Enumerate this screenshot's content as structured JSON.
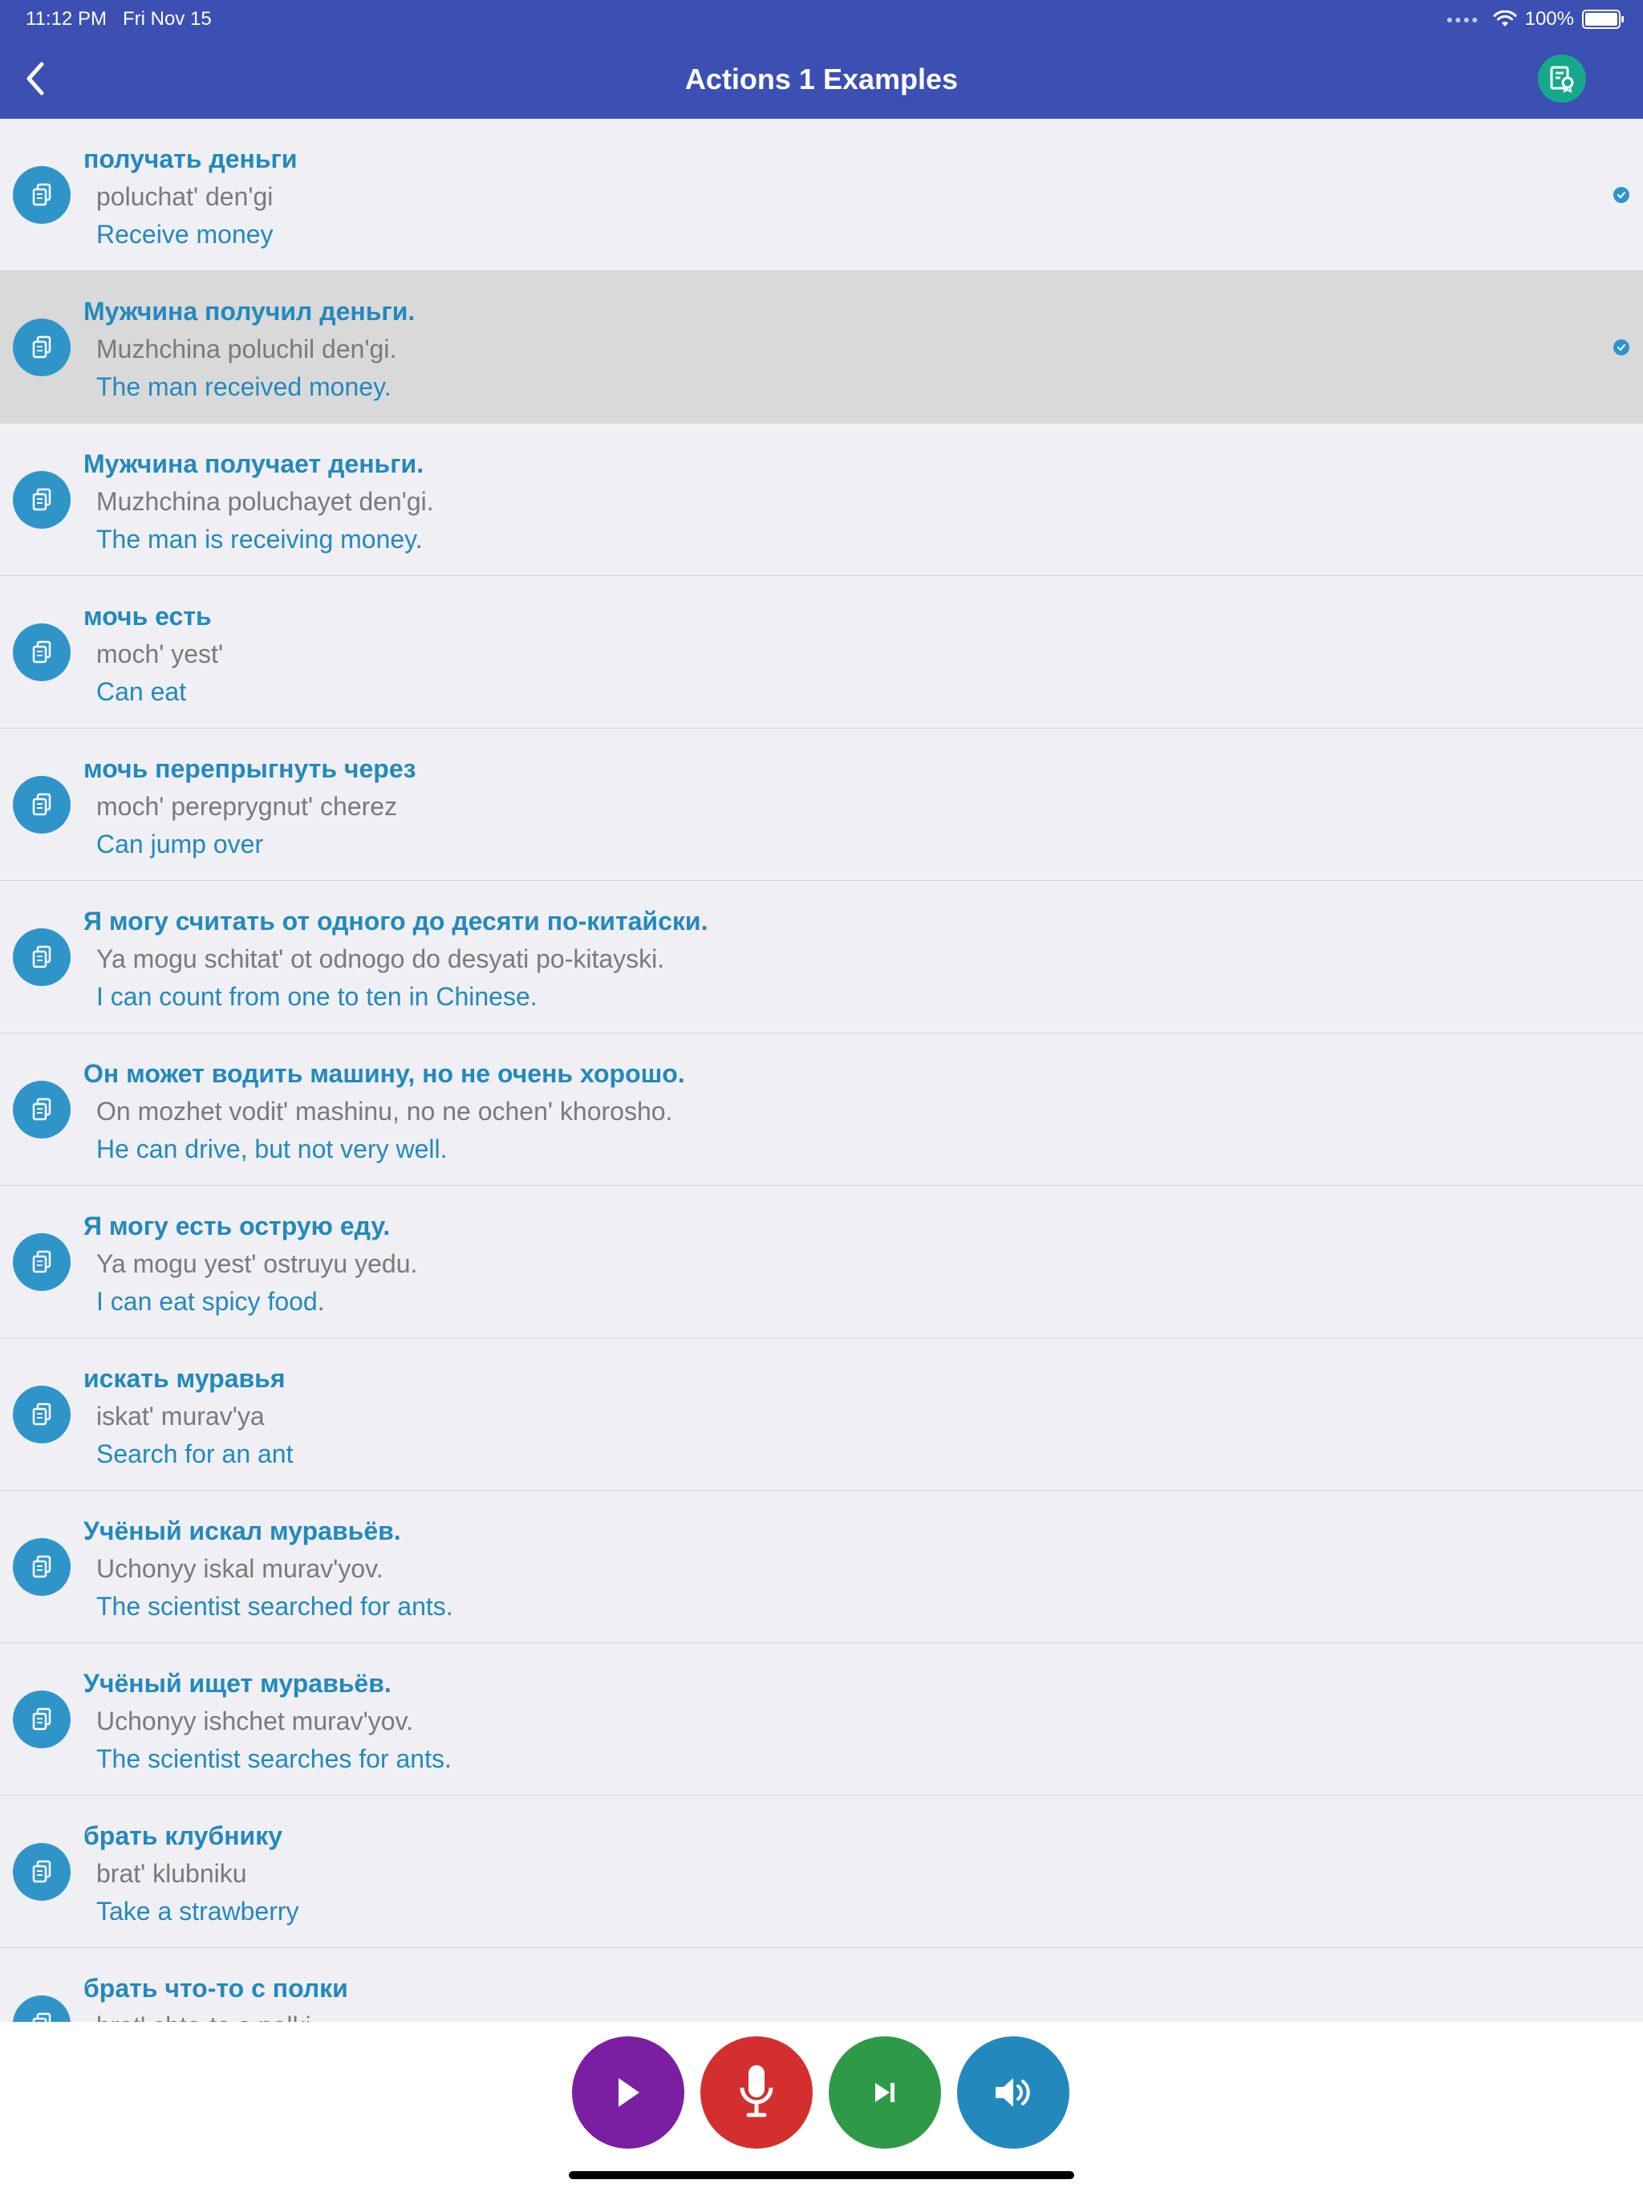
{
  "status_bar": {
    "time": "11:12 PM",
    "date": "Fri Nov 15",
    "battery": "100%"
  },
  "nav": {
    "title": "Actions 1 Examples",
    "back_icon": "chevron-left-icon",
    "action_icon": "certificate-icon"
  },
  "items": [
    {
      "ru": "получать деньги",
      "tr": "poluchat' den'gi",
      "en": "Receive money",
      "checked": true,
      "selected": false
    },
    {
      "ru": "Мужчина получил деньги.",
      "tr": "Muzhchina poluchil den'gi.",
      "en": "The man received money.",
      "checked": true,
      "selected": true
    },
    {
      "ru": "Мужчина получает деньги.",
      "tr": "Muzhchina poluchayet den'gi.",
      "en": "The man is receiving money.",
      "checked": false,
      "selected": false
    },
    {
      "ru": "мочь есть",
      "tr": "moch' yest'",
      "en": "Can eat",
      "checked": false,
      "selected": false
    },
    {
      "ru": "мочь перепрыгнуть через",
      "tr": "moch' pereprygnut' cherez",
      "en": "Can jump over",
      "checked": false,
      "selected": false
    },
    {
      "ru": "Я могу считать от одного до десяти по-китайски.",
      "tr": "Ya mogu schitat' ot odnogo do desyati po-kitayski.",
      "en": "I can count from one to ten in Chinese.",
      "checked": false,
      "selected": false
    },
    {
      "ru": "Он может водить машину, но не очень хорошо.",
      "tr": "On mozhet vodit' mashinu, no ne ochen' khorosho.",
      "en": "He can drive, but not very well.",
      "checked": false,
      "selected": false
    },
    {
      "ru": "Я могу есть острую еду.",
      "tr": "Ya mogu yest' ostruyu yedu.",
      "en": "I can eat spicy food.",
      "checked": false,
      "selected": false
    },
    {
      "ru": "искать муравья",
      "tr": "iskat' murav'ya",
      "en": "Search for an ant",
      "checked": false,
      "selected": false
    },
    {
      "ru": "Учёный искал муравьёв.",
      "tr": "Uchonyy iskal murav'yov.",
      "en": "The scientist searched for ants.",
      "checked": false,
      "selected": false
    },
    {
      "ru": "Учёный ищет муравьёв.",
      "tr": "Uchonyy ishchet murav'yov.",
      "en": "The scientist searches for ants.",
      "checked": false,
      "selected": false
    },
    {
      "ru": "брать клубнику",
      "tr": "brat' klubniku",
      "en": "Take a strawberry",
      "checked": false,
      "selected": false
    },
    {
      "ru": "брать что-то с полки",
      "tr": "brat' chto-to s polki",
      "en": "",
      "checked": false,
      "selected": false
    }
  ],
  "controls": {
    "play_icon": "play-icon",
    "mic_icon": "microphone-icon",
    "next_icon": "skip-next-icon",
    "sound_icon": "speaker-icon",
    "colors": {
      "play": "#7b1fa2",
      "mic": "#d32f2f",
      "next": "#2e9a48",
      "sound": "#2389bd"
    }
  },
  "colors": {
    "nav_bg": "#3c4fb3",
    "accent": "#2389bd",
    "translit": "#7a7a7a"
  }
}
